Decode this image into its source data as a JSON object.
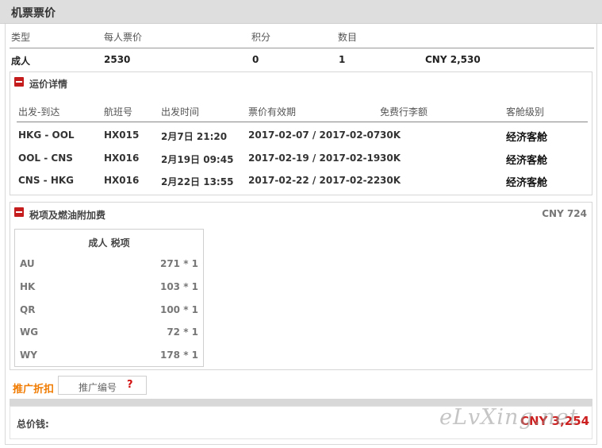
{
  "header": {
    "title": "机票票价"
  },
  "fare_table": {
    "columns": [
      "类型",
      "每人票价",
      "积分",
      "数目"
    ],
    "adult": {
      "type": "成人",
      "price": "2530",
      "points": "0",
      "count": "1",
      "subtotal": "CNY 2,530"
    }
  },
  "fare_details": {
    "title": "运价详情",
    "columns": [
      "出发-到达",
      "航班号",
      "出发时间",
      "票价有效期",
      "免费行李额",
      "客舱级别"
    ],
    "rows": [
      {
        "route": "HKG - OOL",
        "flight": "HX015",
        "depart": "2月7日 21:20",
        "validity": "2017-02-07 / 2017-02-07",
        "baggage": "30K",
        "cabin": "经济客舱"
      },
      {
        "route": "OOL - CNS",
        "flight": "HX016",
        "depart": "2月19日 09:45",
        "validity": "2017-02-19 / 2017-02-19",
        "baggage": "30K",
        "cabin": "经济客舱"
      },
      {
        "route": "CNS - HKG",
        "flight": "HX016",
        "depart": "2月22日 13:55",
        "validity": "2017-02-22 / 2017-02-22",
        "baggage": "30K",
        "cabin": "经济客舱"
      }
    ]
  },
  "taxes": {
    "title": "税项及燃油附加费",
    "total": "CNY 724",
    "box_title": "成人 税项",
    "rows": [
      {
        "code": "AU",
        "amount": "271 * 1"
      },
      {
        "code": "HK",
        "amount": "103 * 1"
      },
      {
        "code": "QR",
        "amount": "100 * 1"
      },
      {
        "code": "WG",
        "amount": "72 * 1"
      },
      {
        "code": "WY",
        "amount": "178 * 1"
      }
    ]
  },
  "promo": {
    "label": "推广折扣",
    "placeholder": "推广编号",
    "help": "?"
  },
  "total": {
    "label": "总价钱:",
    "value": "CNY 3,254"
  },
  "watermark": "eLvXing.net",
  "colors": {
    "accent_red": "#cc1f1f",
    "promo_orange": "#f07b00",
    "header_bg": "#dedede"
  }
}
